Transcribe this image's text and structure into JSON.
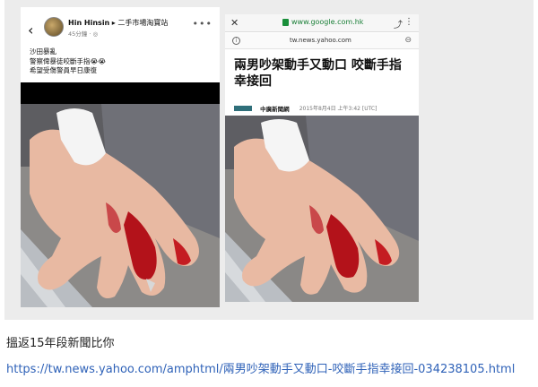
{
  "left_post": {
    "back_icon": "chevron-left-icon",
    "author": "Hin Hinsin",
    "group": "二手市場淘寶站",
    "time": "45分鐘",
    "more_icon": "more-dots-icon",
    "lines": [
      "沙田暴亂",
      "警察俾暴徒咬斷手指😭😭",
      "希望受傷警員早日康復"
    ]
  },
  "right_browser": {
    "close_icon": "close-icon",
    "host": "www.google.com.hk",
    "url": "tw.news.yahoo.com",
    "headline": "兩男吵架動手又動口 咬斷手指幸接回",
    "source": "中廣新聞網",
    "date": "2015年8月4日 上午3:42 [UTC]"
  },
  "caption": {
    "text": "搵返15年段新聞比你",
    "link": "https://tw.news.yahoo.com/amphtml/兩男吵架動手又動口-咬斷手指幸接回-034238105.html"
  }
}
